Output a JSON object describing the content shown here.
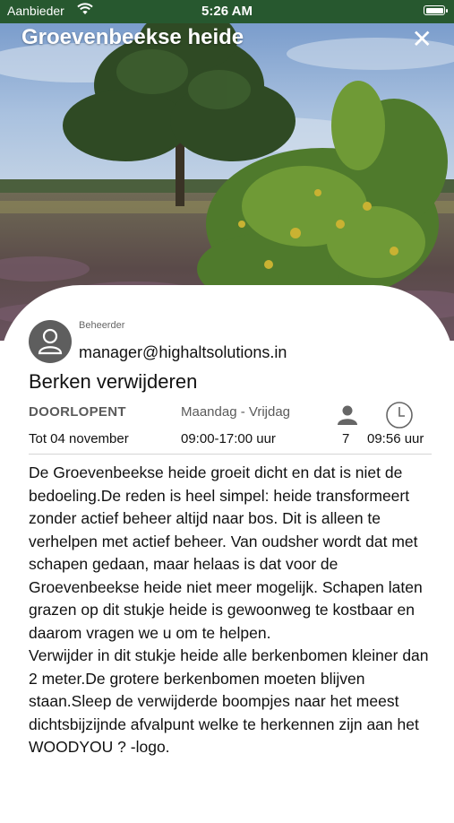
{
  "status_bar": {
    "carrier": "Aanbieder",
    "time": "5:26 AM",
    "battery_level": 1.0
  },
  "header": {
    "title": "Groevenbeekse heide",
    "close_label": "✕"
  },
  "task": {
    "role_label": "Beheerder",
    "manager_email": "manager@highaltsolutions.in",
    "title": "Berken verwijderen",
    "status": "DOORLOPENT",
    "days": "Maandag - Vrijdag",
    "until": "Tot 04 november",
    "hours": "09:00-17:00 uur",
    "participants": "7",
    "duration": "09:56 uur",
    "description": "De Groevenbeekse heide groeit dicht en dat is niet de bedoeling.De reden is heel simpel: heide transformeert zonder actief beheer altijd naar bos. Dit is alleen te verhelpen met actief beheer. Van oudsher wordt dat met schapen gedaan, maar helaas is dat voor de Groevenbeekse heide niet meer mogelijk. Schapen laten grazen op dit stukje heide is gewoonweg te kostbaar en daarom vragen we u om te helpen.\nVerwijder in dit stukje heide alle berkenbomen kleiner dan 2 meter.De grotere berkenbomen moeten blijven staan.Sleep de verwijderde boompjes naar het meest dichtsbijzijnde afvalpunt welke te herkennen zijn aan het WOODYOU ? -logo."
  },
  "icons": {
    "wifi": "wifi-icon",
    "battery": "battery-icon",
    "close": "close-icon",
    "avatar": "user-avatar-icon",
    "participants": "person-icon",
    "duration": "clock-icon"
  },
  "colors": {
    "status_bar": "#27582f",
    "muted_text": "#5a5a5a"
  }
}
